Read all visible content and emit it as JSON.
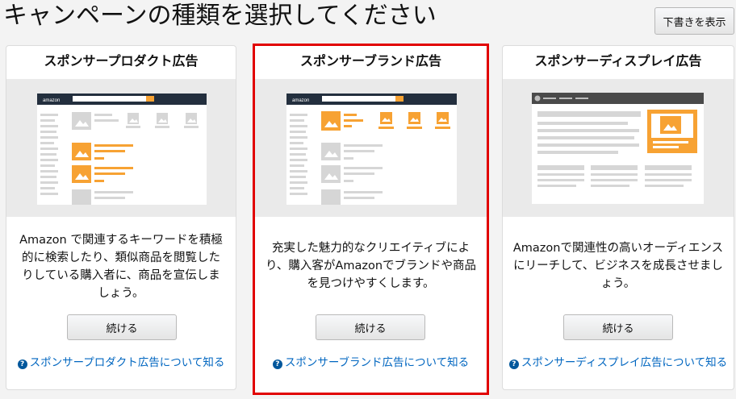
{
  "page": {
    "title": "キャンペーンの種類を選択してください",
    "draft_button": "下書きを表示"
  },
  "cards": [
    {
      "title": "スポンサープロダクト広告",
      "description": "Amazon で関連するキーワードを積極的に検索したり、類似商品を閲覧したりしている購入者に、商品を宣伝しましょう。",
      "button": "続ける",
      "learn_more": "スポンサープロダクト広告について知る",
      "preview_logo": "amazon"
    },
    {
      "title": "スポンサーブランド広告",
      "description": "充実した魅力的なクリエイティブにより、購入客がAmazonでブランドや商品を見つけやすくします。",
      "button": "続ける",
      "learn_more": "スポンサーブランド広告について知る",
      "preview_logo": "amazon",
      "selected": true
    },
    {
      "title": "スポンサーディスプレイ広告",
      "description": "Amazonで関連性の高いオーディエンスにリーチして、ビジネスを成長させましょう。",
      "button": "続ける",
      "learn_more": "スポンサーディスプレイ広告について知る"
    }
  ],
  "colors": {
    "accent_orange": "#f7a233",
    "selected_border": "#e10000",
    "link_blue": "#0066c0",
    "header_dark": "#232f3e"
  },
  "icons": {
    "help": "help-circle-icon",
    "image_placeholder": "image-icon",
    "search": "search-icon"
  }
}
